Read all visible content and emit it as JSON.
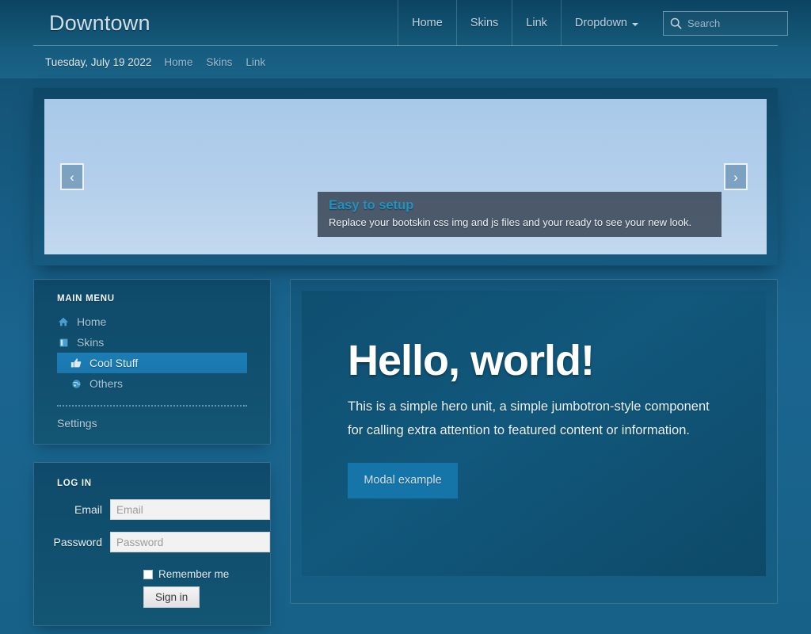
{
  "header": {
    "brand": "Downtown",
    "nav_links": [
      {
        "label": "Home",
        "name": "nav-link-home"
      },
      {
        "label": "Skins",
        "name": "nav-link-skins"
      },
      {
        "label": "Link",
        "name": "nav-link-link"
      },
      {
        "label": "Dropdown",
        "name": "nav-link-dropdown",
        "has_caret": true
      }
    ],
    "search": {
      "placeholder": "Search",
      "value": "",
      "icon": "search-icon"
    }
  },
  "subbar": {
    "date": "Tuesday, July 19 2022",
    "links": [
      "Home",
      "Skins",
      "Link"
    ]
  },
  "carousel": {
    "prev_label": "‹",
    "next_label": "›",
    "caption_title": "Easy to setup",
    "caption_text": "Replace your bootskin css img and js files and your ready to see your new look."
  },
  "sidebar": {
    "menu_heading": "MAIN MENU",
    "items": [
      {
        "label": "Home",
        "icon": "home-icon",
        "active": false,
        "sub": false
      },
      {
        "label": "Skins",
        "icon": "book-icon",
        "active": false,
        "sub": false
      },
      {
        "label": "Cool Stuff",
        "icon": "thumbs-up-icon",
        "active": true,
        "sub": true
      },
      {
        "label": "Others",
        "icon": "globe-icon",
        "active": false,
        "sub": true
      }
    ],
    "settings_label": "Settings",
    "login": {
      "heading": "LOG IN",
      "email_label": "Email",
      "email_placeholder": "Email",
      "email_value": "",
      "password_label": "Password",
      "password_placeholder": "Password",
      "password_value": "",
      "remember_label": "Remember me",
      "remember_checked": false,
      "signin_label": "Sign in"
    }
  },
  "jumbotron": {
    "title": "Hello, world!",
    "text": "This is a simple hero unit, a simple jumbotron-style component for calling extra attention to featured content or information.",
    "button_label": "Modal example"
  },
  "colors": {
    "page_bg": "#1a6590",
    "navbar_bg": "#11506f",
    "panel_bg": "#11506f",
    "accent": "#1b7db5",
    "caption_title": "#1f93c4",
    "modal_button": "#1574a8",
    "jumbotron_bg": "#11587c"
  }
}
